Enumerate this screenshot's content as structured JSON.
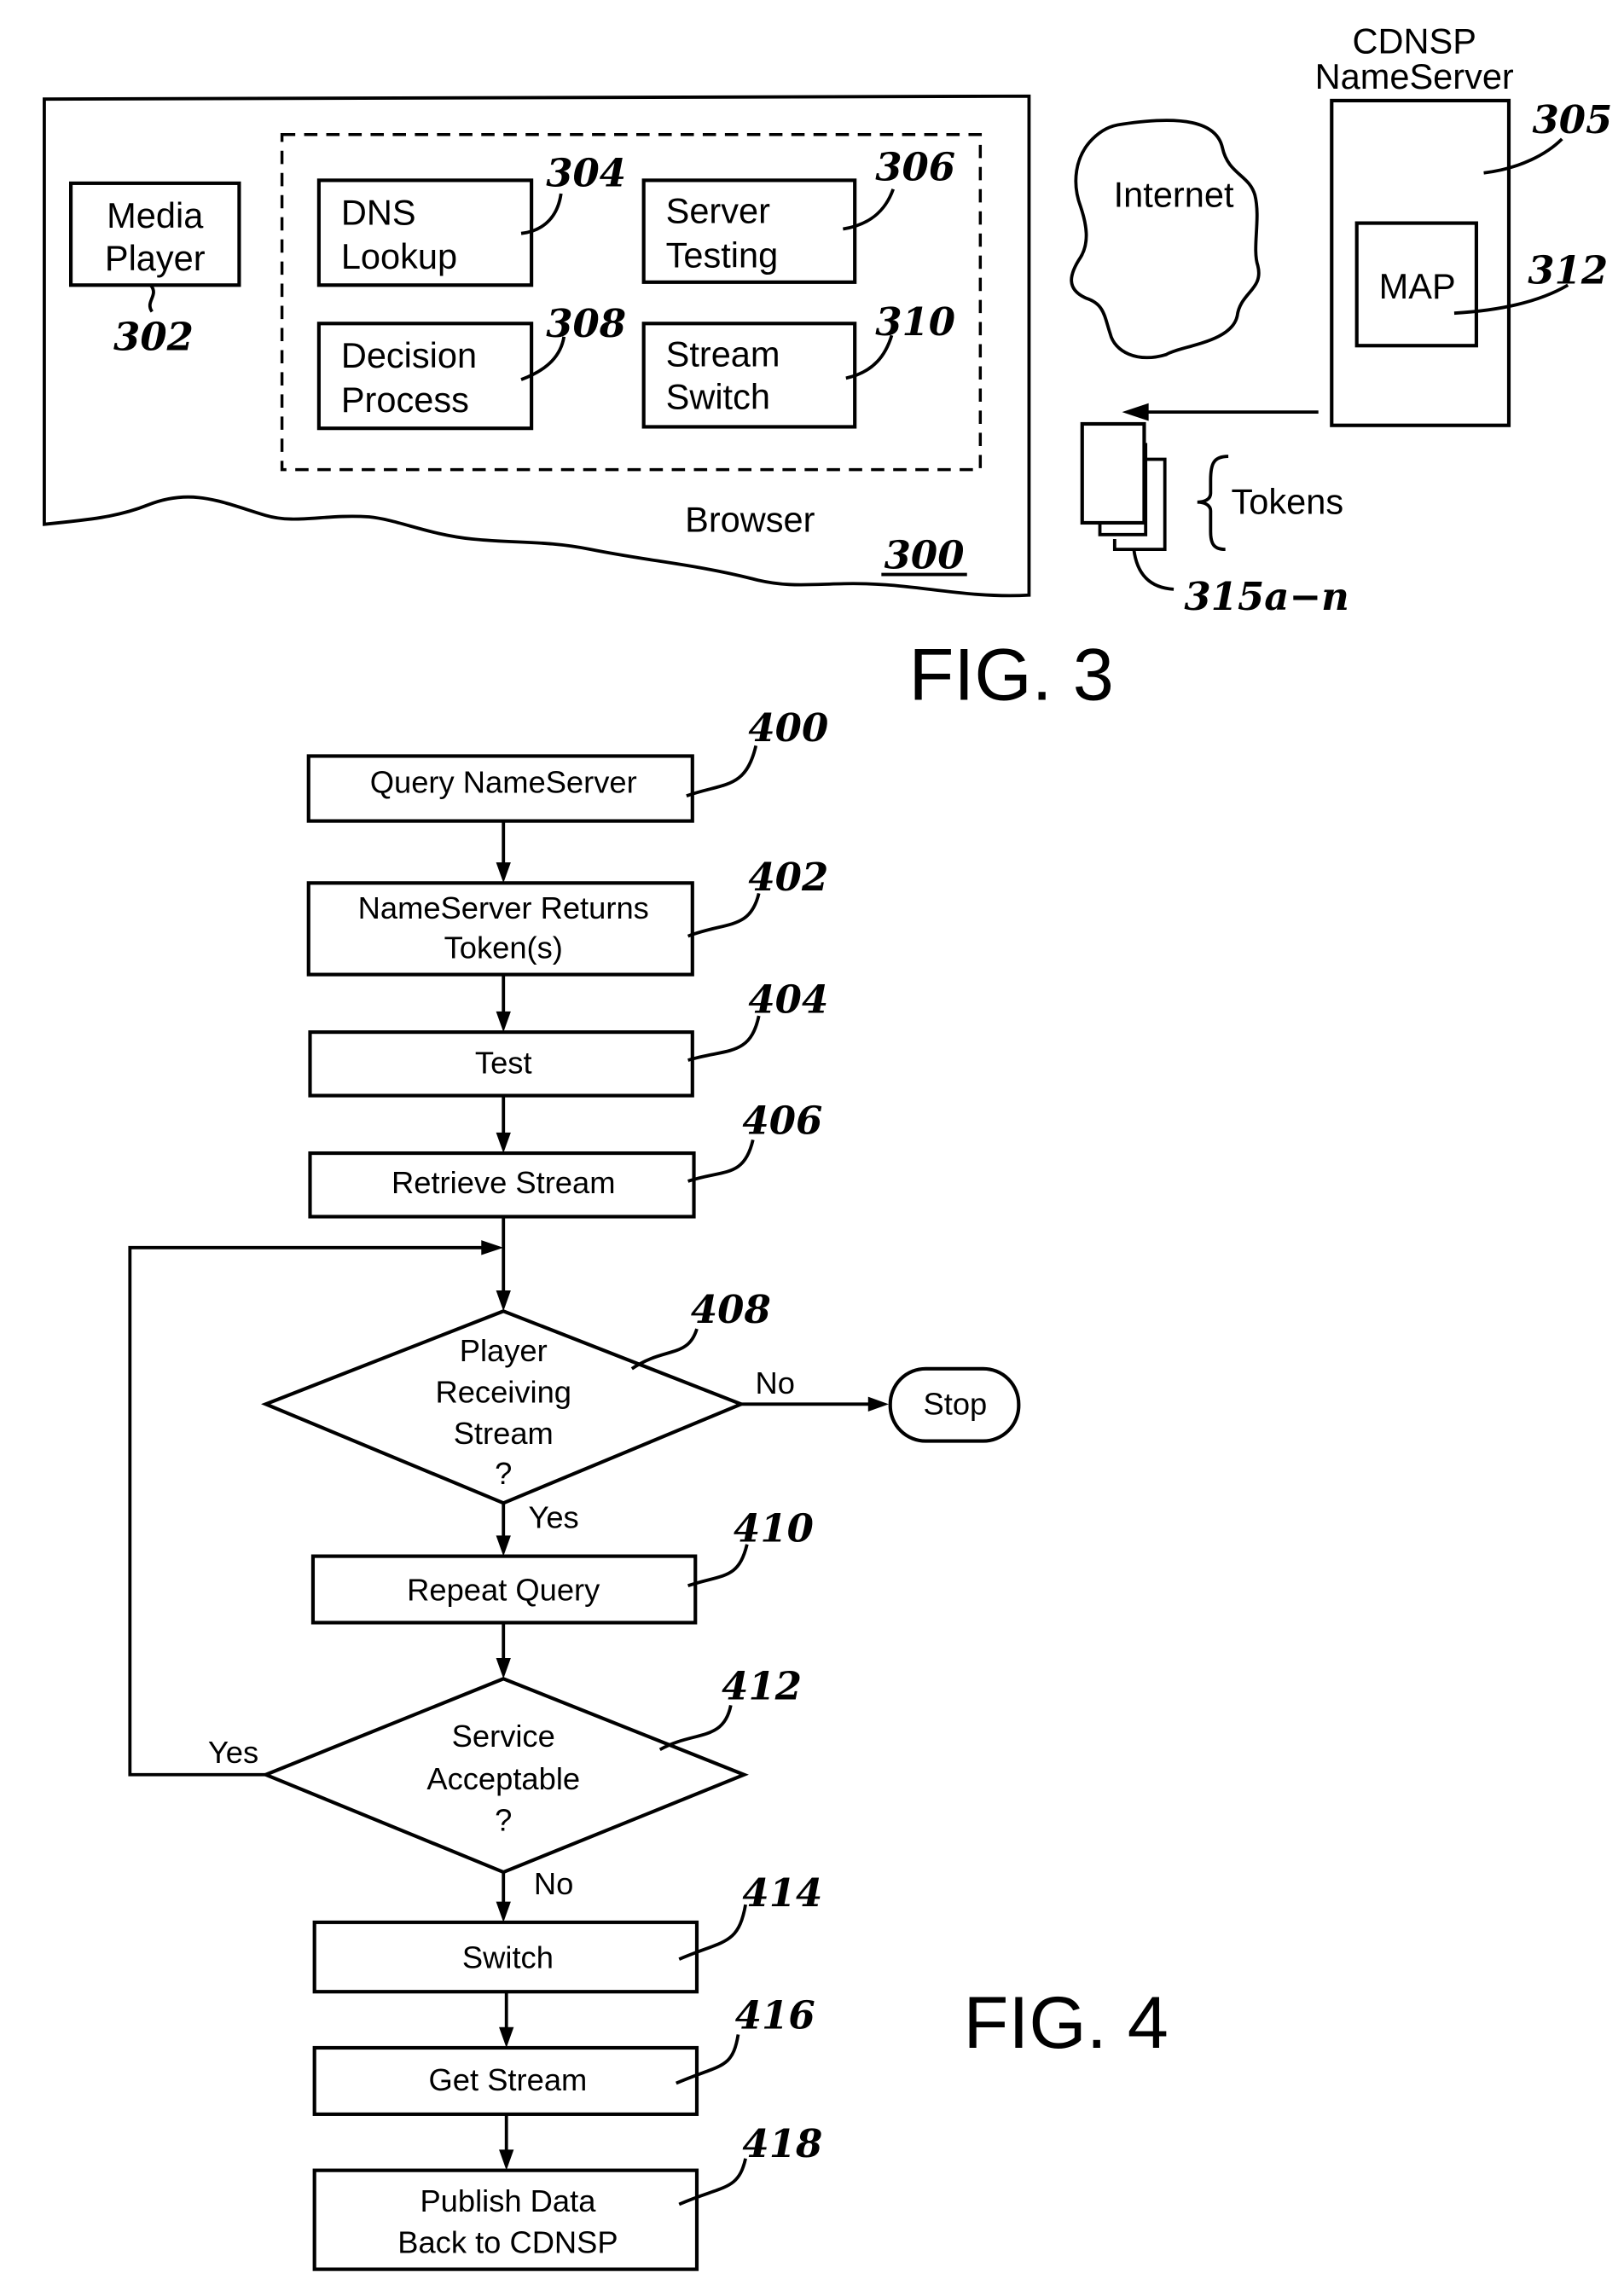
{
  "fig3": {
    "caption": "FIG. 3",
    "browser": {
      "label": "Browser",
      "ref": "300"
    },
    "media_player": {
      "lines": [
        "Media",
        "Player"
      ],
      "ref": "302"
    },
    "dns_lookup": {
      "lines": [
        "DNS",
        "Lookup"
      ],
      "ref": "304"
    },
    "server_testing": {
      "lines": [
        "Server",
        "Testing"
      ],
      "ref": "306"
    },
    "decision_process": {
      "lines": [
        "Decision",
        "Process"
      ],
      "ref": "308"
    },
    "stream_switch": {
      "lines": [
        "Stream",
        "Switch"
      ],
      "ref": "310"
    },
    "internet": {
      "label": "Internet"
    },
    "nameserver": {
      "title_lines": [
        "CDNSP",
        "NameServer"
      ],
      "ref": "305"
    },
    "map": {
      "label": "MAP",
      "ref": "312"
    },
    "tokens": {
      "label": "Tokens",
      "ref": "315a−n"
    }
  },
  "fig4": {
    "caption": "FIG. 4",
    "steps": [
      {
        "ref": "400",
        "lines": [
          "Query NameServer"
        ]
      },
      {
        "ref": "402",
        "lines": [
          "NameServer Returns",
          "Token(s)"
        ]
      },
      {
        "ref": "404",
        "lines": [
          "Test"
        ]
      },
      {
        "ref": "406",
        "lines": [
          "Retrieve Stream"
        ]
      },
      {
        "ref": "408",
        "lines": [
          "Player",
          "Receiving",
          "Stream",
          "?"
        ]
      },
      {
        "ref": "410",
        "lines": [
          "Repeat Query"
        ]
      },
      {
        "ref": "412",
        "lines": [
          "Service",
          "Acceptable",
          "?"
        ]
      },
      {
        "ref": "414",
        "lines": [
          "Switch"
        ]
      },
      {
        "ref": "416",
        "lines": [
          "Get Stream"
        ]
      },
      {
        "ref": "418",
        "lines": [
          "Publish Data",
          "Back to CDNSP"
        ]
      }
    ],
    "stop_label": "Stop",
    "decision408": {
      "no_label": "No",
      "yes_label": "Yes"
    },
    "decision412": {
      "yes_label": "Yes",
      "no_label": "No"
    }
  }
}
